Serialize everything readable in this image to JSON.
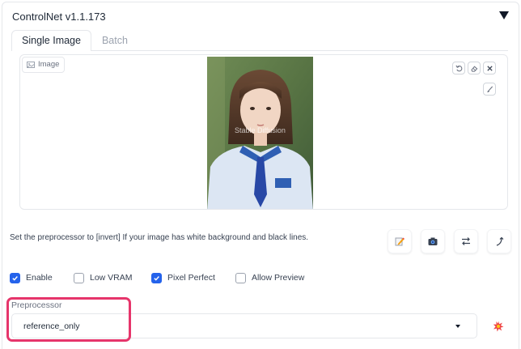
{
  "panel": {
    "title": "ControlNet v1.1.173",
    "collapse_icon": "triangle-down-icon"
  },
  "tabs": [
    {
      "label": "Single Image",
      "active": true
    },
    {
      "label": "Batch",
      "active": false
    }
  ],
  "image_input": {
    "label": "Image",
    "label_icon": "image-icon",
    "watermark": "Stable Diffusion",
    "tools": [
      "undo-icon",
      "eraser-icon",
      "close-icon"
    ],
    "brush_icon": "brush-icon"
  },
  "hint": "Set the preprocessor to [invert] If your image has white background and black lines.",
  "action_icons": [
    "edit-icon",
    "camera-icon",
    "swap-icon",
    "curve-arrow-icon"
  ],
  "checkboxes": [
    {
      "label": "Enable",
      "checked": true
    },
    {
      "label": "Low VRAM",
      "checked": false
    },
    {
      "label": "Pixel Perfect",
      "checked": true
    },
    {
      "label": "Allow Preview",
      "checked": false
    }
  ],
  "preprocessor": {
    "label": "Preprocessor",
    "value": "reference_only"
  },
  "run_icon": "explosion-icon",
  "colors": {
    "accent": "#2563eb",
    "highlight": "#e6356b"
  }
}
